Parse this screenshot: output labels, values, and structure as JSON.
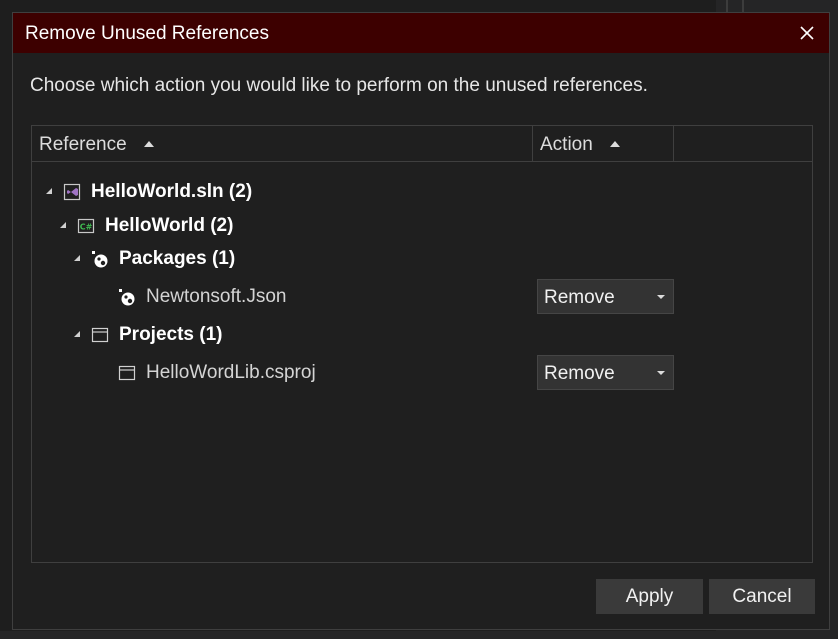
{
  "dialog": {
    "title": "Remove Unused References",
    "instruction": "Choose which action you would like to perform on the unused references."
  },
  "grid": {
    "columns": [
      {
        "label": "Reference",
        "sort": "ascending"
      },
      {
        "label": "Action",
        "sort": "ascending"
      }
    ],
    "rows": [
      {
        "label": "HelloWorld.sln (2)",
        "icon": "solution-icon",
        "expanded": true
      },
      {
        "label": "HelloWorld (2)",
        "icon": "csharp-project-icon",
        "expanded": true
      },
      {
        "label": "Packages (1)",
        "icon": "packages-icon",
        "expanded": true
      },
      {
        "label": "Newtonsoft.Json",
        "icon": "package-icon",
        "action": "Remove"
      },
      {
        "label": "Projects (1)",
        "icon": "projects-icon",
        "expanded": true
      },
      {
        "label": "HelloWordLib.csproj",
        "icon": "project-icon",
        "action": "Remove"
      }
    ]
  },
  "buttons": {
    "apply": "Apply",
    "cancel": "Cancel"
  },
  "colors": {
    "titlebar": "#3d0000",
    "background": "#1f1f1f",
    "csharp": "#3fb950",
    "solution": "#a074c4"
  }
}
